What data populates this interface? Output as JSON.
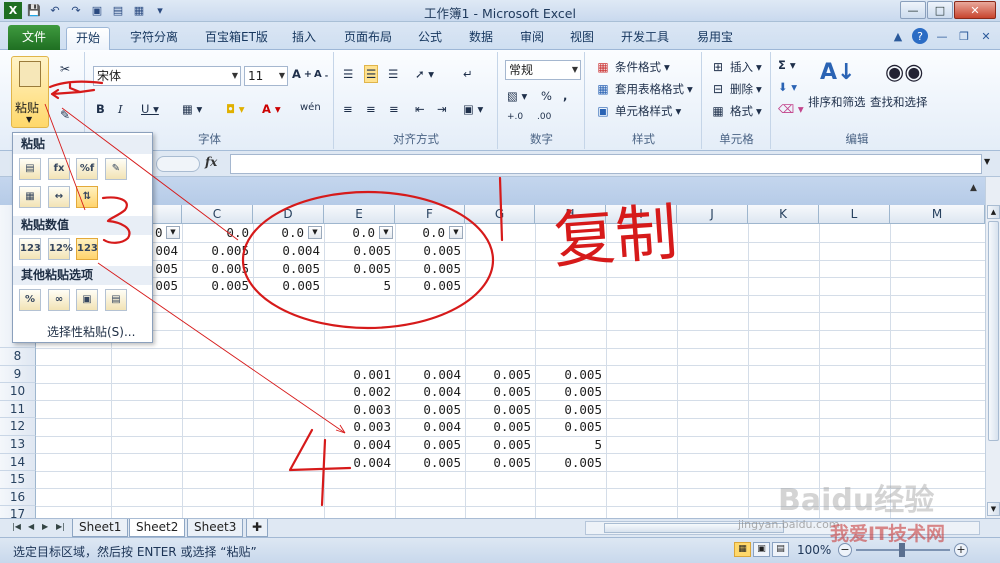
{
  "window": {
    "title": "工作簿1 - Microsoft Excel",
    "controls": [
      "—",
      "□",
      "✕"
    ]
  },
  "tabs": [
    "文件",
    "开始",
    "字符分离",
    "百宝箱ET版",
    "插入",
    "页面布局",
    "公式",
    "数据",
    "审阅",
    "视图",
    "开发工具",
    "易用宝"
  ],
  "ribbon": {
    "clipboard": {
      "paste_label": "粘贴"
    },
    "font": {
      "name": "宋体",
      "size": "11",
      "group_label": "字体"
    },
    "alignment": {
      "group_label": "对齐方式"
    },
    "number": {
      "format": "常规",
      "group_label": "数字"
    },
    "styles": {
      "conditional": "条件格式",
      "table": "套用表格格式",
      "cell": "单元格样式",
      "group_label": "样式"
    },
    "cells": {
      "insert": "插入",
      "delete": "删除",
      "format": "格式",
      "group_label": "单元格"
    },
    "editing": {
      "sort": "排序和筛选",
      "find": "查找和选择",
      "group_label": "编辑"
    }
  },
  "formula_bar": {
    "fx": "fx",
    "value": ""
  },
  "columns": [
    "C",
    "D",
    "E",
    "F",
    "G",
    "H",
    "I",
    "J",
    "K",
    "L",
    "M"
  ],
  "rows": [
    "8",
    "9",
    "10",
    "11",
    "12",
    "13",
    "14",
    "15",
    "16",
    "17"
  ],
  "top_cells": {
    "r1": [
      "0",
      "0.0",
      "0.0",
      "0.0",
      "0.0"
    ],
    "r2": [
      "004",
      "0.005",
      "0.004",
      "0.005",
      "0.005"
    ],
    "r3": [
      "005",
      "0.005",
      "0.005",
      "0.005",
      "0.005"
    ],
    "r4": [
      "005",
      "0.005",
      "0.005",
      "5",
      "0.005"
    ]
  },
  "pasted_cells": [
    [
      "0.001",
      "0.004",
      "0.005",
      "0.005"
    ],
    [
      "0.002",
      "0.004",
      "0.005",
      "0.005"
    ],
    [
      "0.003",
      "0.005",
      "0.005",
      "0.005"
    ],
    [
      "0.003",
      "0.004",
      "0.005",
      "0.005"
    ],
    [
      "0.004",
      "0.005",
      "0.005",
      "5"
    ],
    [
      "0.004",
      "0.005",
      "0.005",
      "0.005"
    ]
  ],
  "paste_menu": {
    "section1": "粘贴",
    "section2": "粘贴数值",
    "section3": "其他粘贴选项",
    "special": "选择性粘贴(S)..."
  },
  "sheets": [
    "Sheet1",
    "Sheet2",
    "Sheet3"
  ],
  "active_sheet": "Sheet2",
  "status": {
    "text": "选定目标区域，然后按 ENTER 或选择 “粘贴”",
    "zoom": "100%"
  },
  "annotation": {
    "copy_text": "复制"
  },
  "watermark": {
    "main": "Baidu经验",
    "site": "我爱IT技术网",
    "url": "jingyan.baidu.com"
  }
}
